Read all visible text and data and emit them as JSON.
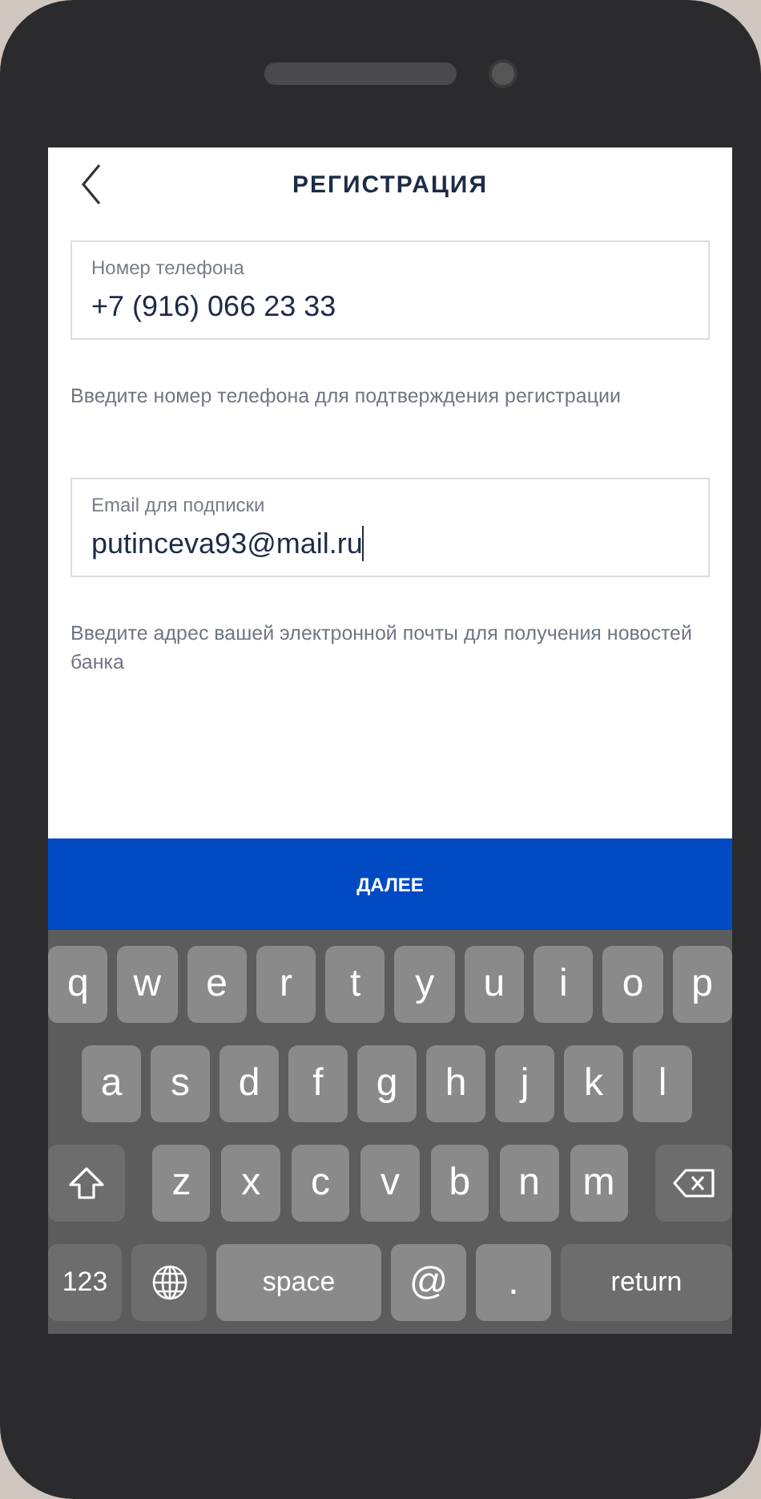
{
  "header": {
    "title": "РЕГИСТРАЦИЯ"
  },
  "fields": [
    {
      "label": "Номер телефона",
      "value": "+7 (916) 066 23 33",
      "hint": "Введите номер телефона для подтверждения регистрации",
      "focused": false
    },
    {
      "label": "Email для подписки",
      "value": "putinceva93@mail.ru",
      "hint": "Введите адрес вашей электронной почты для получения новостей банка",
      "focused": true
    }
  ],
  "submit_button": "ДАЛЕЕ",
  "keyboard": {
    "rows": [
      {
        "keys": [
          {
            "kind": "letter",
            "label": "q"
          },
          {
            "kind": "letter",
            "label": "w"
          },
          {
            "kind": "letter",
            "label": "e"
          },
          {
            "kind": "letter",
            "label": "r"
          },
          {
            "kind": "letter",
            "label": "t"
          },
          {
            "kind": "letter",
            "label": "y"
          },
          {
            "kind": "letter",
            "label": "u"
          },
          {
            "kind": "letter",
            "label": "i"
          },
          {
            "kind": "letter",
            "label": "o"
          },
          {
            "kind": "letter",
            "label": "p"
          }
        ]
      },
      {
        "keys": [
          {
            "kind": "letter",
            "label": "a"
          },
          {
            "kind": "letter",
            "label": "s"
          },
          {
            "kind": "letter",
            "label": "d"
          },
          {
            "kind": "letter",
            "label": "f"
          },
          {
            "kind": "letter",
            "label": "g"
          },
          {
            "kind": "letter",
            "label": "h"
          },
          {
            "kind": "letter",
            "label": "j"
          },
          {
            "kind": "letter",
            "label": "k"
          },
          {
            "kind": "letter",
            "label": "l"
          }
        ]
      },
      {
        "keys": [
          {
            "kind": "shift"
          },
          {
            "kind": "letter",
            "label": "z"
          },
          {
            "kind": "letter",
            "label": "x"
          },
          {
            "kind": "letter",
            "label": "c"
          },
          {
            "kind": "letter",
            "label": "v"
          },
          {
            "kind": "letter",
            "label": "b"
          },
          {
            "kind": "letter",
            "label": "n"
          },
          {
            "kind": "letter",
            "label": "m"
          },
          {
            "kind": "backspace"
          }
        ]
      },
      {
        "keys": [
          {
            "kind": "mode",
            "label": "123"
          },
          {
            "kind": "globe"
          },
          {
            "kind": "space",
            "label": "space"
          },
          {
            "kind": "symbol",
            "label": "@"
          },
          {
            "kind": "symbol",
            "label": "."
          },
          {
            "kind": "return",
            "label": "return"
          }
        ]
      }
    ]
  }
}
